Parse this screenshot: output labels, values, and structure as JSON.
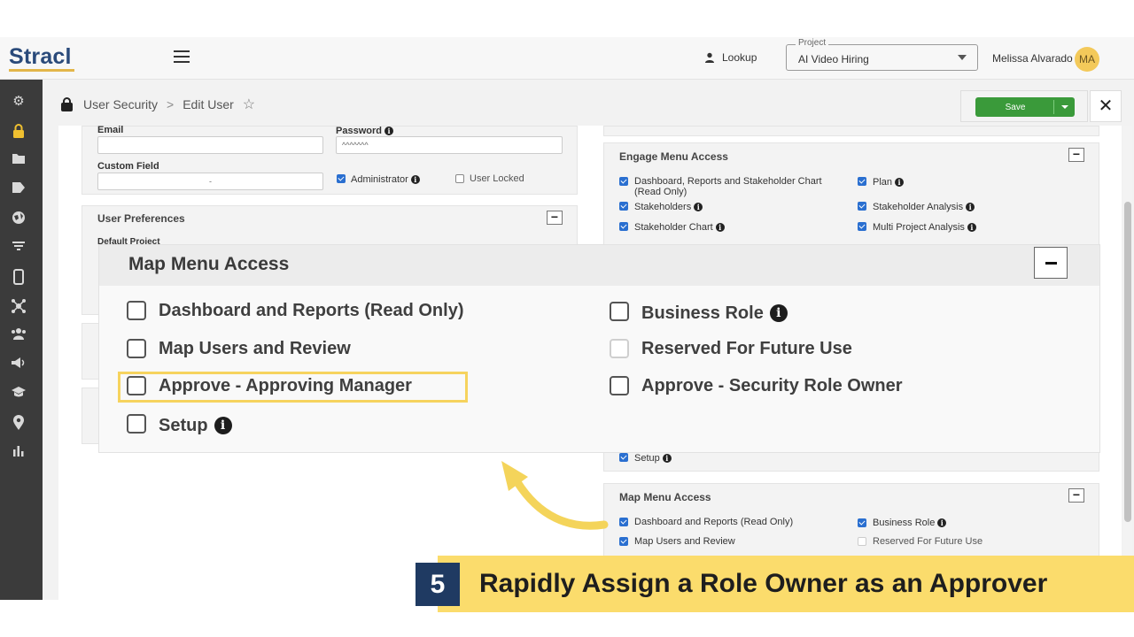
{
  "app": {
    "logo": "Stracl",
    "lookup_label": "Lookup",
    "project": {
      "legend": "Project",
      "value": "AI Video Hiring"
    },
    "user": {
      "name": "Melissa Alvarado",
      "initials": "MA"
    },
    "colors": {
      "brand": "#2a4a7a",
      "accent": "#f0c030",
      "save": "#3a9a3a",
      "highlight": "#f6d35e",
      "banner": "#fbdc6c",
      "banner_num": "#1f3a62"
    }
  },
  "sidebar": {
    "icons": [
      "gear-icon",
      "lock-icon",
      "folder-icon",
      "tag-icon",
      "globe-icon",
      "filter-icon",
      "mobile-icon",
      "network-icon",
      "users-icon",
      "megaphone-icon",
      "graduation-cap-icon",
      "map-pin-icon",
      "bar-chart-icon"
    ]
  },
  "breadcrumb": {
    "items": [
      "User Security",
      "Edit User"
    ],
    "separator": ">"
  },
  "toolbar": {
    "save_label": "Save",
    "close_label": "✕"
  },
  "user_form": {
    "email_label": "Email",
    "password_label": "Password",
    "password_value": "^^^^^^^",
    "custom_field_label": "Custom Field",
    "custom_field_value": "-",
    "administrator_label": "Administrator",
    "user_locked_label": "User Locked"
  },
  "preferences": {
    "title": "User Preferences",
    "default_project_label": "Default Project"
  },
  "engage_menu": {
    "title": "Engage Menu Access",
    "left": [
      {
        "label": "Dashboard, Reports and Stakeholder Chart",
        "label2": "(Read Only)",
        "checked": true
      },
      {
        "label": "Stakeholders",
        "checked": true,
        "info": true
      },
      {
        "label": "Stakeholder Chart",
        "checked": true,
        "info": true
      }
    ],
    "right": [
      {
        "label": "Plan",
        "checked": true,
        "info": true
      },
      {
        "label": "Stakeholder Analysis",
        "checked": true,
        "info": true
      },
      {
        "label": "Multi Project Analysis",
        "checked": true,
        "info": true
      }
    ],
    "setup": {
      "label": "Setup",
      "checked": true,
      "info": true
    }
  },
  "map_menu_small": {
    "title": "Map Menu Access",
    "items": [
      {
        "label": "Dashboard and Reports (Read Only)",
        "checked": true
      },
      {
        "label": "Business Role",
        "checked": true,
        "info": true
      },
      {
        "label": "Map Users and Review",
        "checked": true
      },
      {
        "label": "Reserved For Future Use",
        "checked": false
      }
    ]
  },
  "map_menu_zoom": {
    "title": "Map Menu Access",
    "left": [
      {
        "label": "Dashboard and Reports (Read Only)",
        "checked": false
      },
      {
        "label": "Map Users and Review",
        "checked": false
      },
      {
        "label": "Approve - Approving Manager",
        "checked": false,
        "highlighted": true
      },
      {
        "label": "Setup",
        "checked": false,
        "info": true
      }
    ],
    "right": [
      {
        "label": "Business Role",
        "checked": false,
        "info": true
      },
      {
        "label": "Reserved For Future Use",
        "checked": false,
        "disabled": true
      },
      {
        "label": "Approve - Security Role Owner",
        "checked": false
      }
    ]
  },
  "callout": {
    "number": "5",
    "text": "Rapidly Assign a Role Owner as an Approver"
  }
}
